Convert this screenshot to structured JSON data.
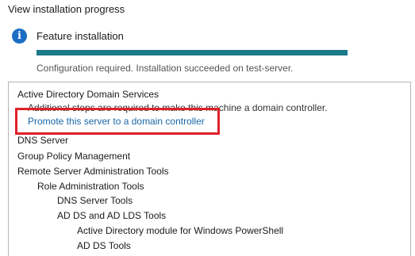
{
  "page": {
    "title": "View installation progress"
  },
  "step": {
    "icon": "info-icon",
    "title": "Feature installation",
    "progress": 1.0,
    "status": "Configuration required. Installation succeeded on test-server."
  },
  "results": {
    "adds": {
      "label": "Active Directory Domain Services",
      "note": "Additional steps are required to make this machine a domain controller.",
      "link": "Promote this server to a domain controller"
    },
    "dns_server": "DNS Server",
    "gpm": "Group Policy Management",
    "rsat": "Remote Server Administration Tools",
    "role_tools": "Role Administration Tools",
    "dns_tools": "DNS Server Tools",
    "adds_lds_tools": "AD DS and AD LDS Tools",
    "ad_ps_module": "Active Directory module for Windows PowerShell",
    "ad_ds_tools_partial": "AD DS Tools"
  },
  "colors": {
    "accent": "#1a7a8a",
    "link": "#1767a8",
    "highlight": "#e0202a"
  }
}
